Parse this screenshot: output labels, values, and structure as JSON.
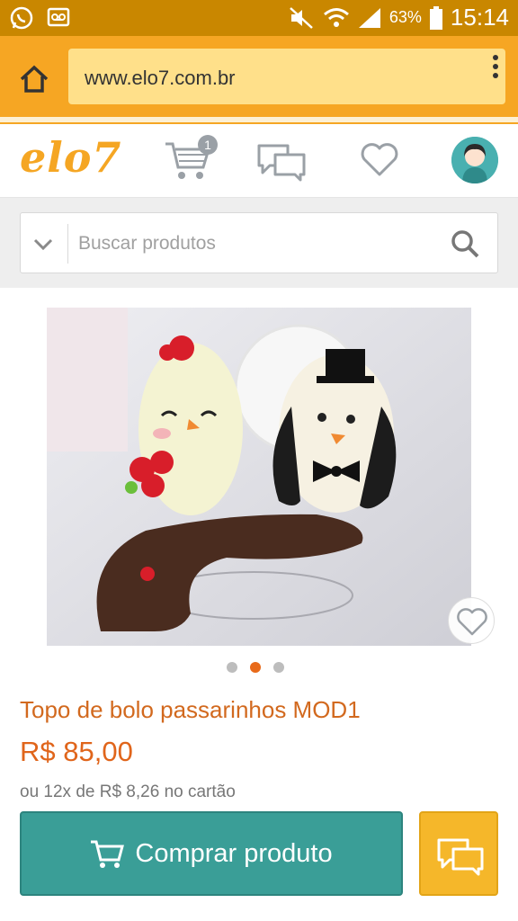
{
  "status_bar": {
    "battery": "63%",
    "time": "15:14"
  },
  "browser": {
    "url": "www.elo7.com.br"
  },
  "app_bar": {
    "logo": "elo7",
    "cart_count": "1"
  },
  "search": {
    "placeholder": "Buscar produtos"
  },
  "product": {
    "title": "Topo de bolo passarinhos MOD1",
    "price": "R$ 85,00",
    "installments": "ou 12x de R$ 8,26 no cartão",
    "image_count": 3,
    "active_image": 2
  },
  "actions": {
    "buy_label": "Comprar produto"
  },
  "colors": {
    "accent_orange": "#f6a623",
    "teal": "#3a9e97",
    "price_orange": "#e0651b"
  }
}
